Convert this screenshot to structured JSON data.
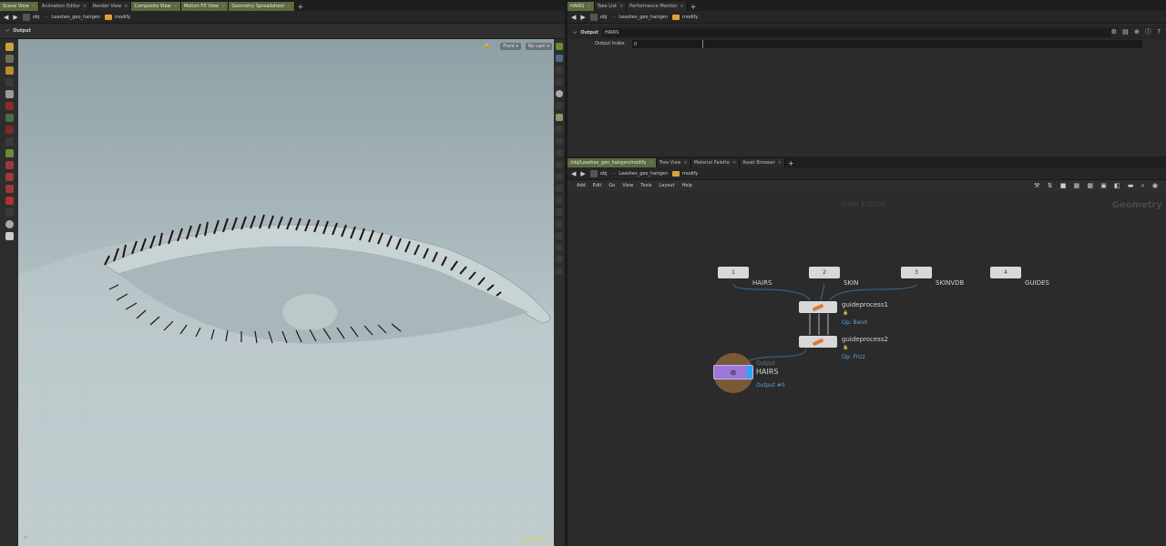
{
  "left_tabs": [
    "Scene View",
    "Animation Editor",
    "Render View",
    "Composite View",
    "Motion FX View",
    "Geometry Spreadsheet"
  ],
  "left_path": {
    "root": "obj",
    "node": "Leashes_geo_hairgen",
    "leaf": "modify"
  },
  "viewport": {
    "title": "Output",
    "camera": "Front",
    "cam_menu": "No cam",
    "edition": "Indie Edition"
  },
  "right_top_tabs": [
    "HAIRS",
    "Take List",
    "Performance Monitor"
  ],
  "right_top_path": {
    "root": "obj",
    "node": "Leashes_geo_hairgen",
    "leaf": "modify"
  },
  "params": {
    "node_type": "Output",
    "node_name": "HAIRS",
    "field_label": "Output Index",
    "field_value": "0"
  },
  "network_tabs": [
    "/obj/Leashes_geo_hairgen/modify",
    "Tree View",
    "Material Palette",
    "Asset Browser"
  ],
  "network_path": {
    "root": "obj",
    "node": "Leashes_geo_hairgen",
    "leaf": "modify"
  },
  "menu": [
    "Add",
    "Edit",
    "Go",
    "View",
    "Tools",
    "Layout",
    "Help"
  ],
  "network": {
    "watermark": "Indie Edition",
    "context": "Geometry",
    "inputs": [
      {
        "num": "1",
        "label": "HAIRS"
      },
      {
        "num": "2",
        "label": "SKIN"
      },
      {
        "num": "3",
        "label": "SKINVDB"
      },
      {
        "num": "4",
        "label": "GUIDES"
      }
    ],
    "gp1": {
      "name": "guideprocess1",
      "op": "Op: Bend"
    },
    "gp2": {
      "name": "guideprocess2",
      "op": "Op: Frizz"
    },
    "output": {
      "type": "Output",
      "name": "HAIRS",
      "sub": "Output #0"
    }
  }
}
